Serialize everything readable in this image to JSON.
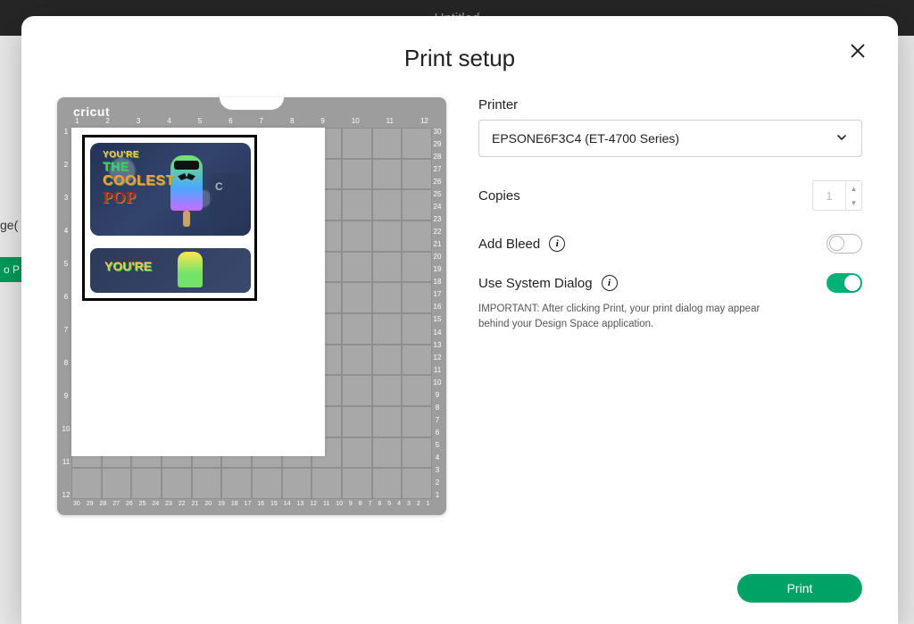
{
  "window": {
    "title": "Untitled"
  },
  "background": {
    "left_fragment": "ge(",
    "left_button": "o P"
  },
  "dialog": {
    "title": "Print setup",
    "printer": {
      "label": "Printer",
      "selected": "EPSONE6F3C4 (ET-4700 Series)"
    },
    "copies": {
      "label": "Copies",
      "value": "1"
    },
    "add_bleed": {
      "label": "Add Bleed",
      "enabled": false
    },
    "use_system_dialog": {
      "label": "Use System Dialog",
      "enabled": true,
      "note": "IMPORTANT: After clicking Print, your print dialog may appear behind your Design Space application."
    },
    "print_button": "Print"
  },
  "mat": {
    "brand": "cricut",
    "ruler_top": [
      "1",
      "2",
      "3",
      "4",
      "5",
      "6",
      "7",
      "8",
      "9",
      "10",
      "11",
      "12"
    ],
    "ruler_side": [
      "1",
      "2",
      "3",
      "4",
      "5",
      "6",
      "7",
      "8",
      "9",
      "10",
      "11",
      "12"
    ],
    "ruler_side_cm": [
      "30",
      "29",
      "28",
      "27",
      "26",
      "25",
      "24",
      "23",
      "22",
      "21",
      "20",
      "19",
      "18",
      "17",
      "16",
      "15",
      "14",
      "13",
      "12",
      "11",
      "10",
      "9",
      "8",
      "7",
      "6",
      "5",
      "4",
      "3",
      "2",
      "1"
    ],
    "ruler_bottom": [
      "30",
      "29",
      "28",
      "27",
      "26",
      "25",
      "24",
      "23",
      "22",
      "21",
      "20",
      "19",
      "18",
      "17",
      "16",
      "15",
      "14",
      "13",
      "12",
      "11",
      "10",
      "9",
      "8",
      "7",
      "6",
      "5",
      "4",
      "3",
      "2",
      "1"
    ]
  },
  "artwork": {
    "line1": "YOU'RE",
    "line2": "THE",
    "line3": "COOLEST",
    "line4": "POP",
    "repeat_line1": "YOU'RE",
    "side_fragment": "C"
  }
}
